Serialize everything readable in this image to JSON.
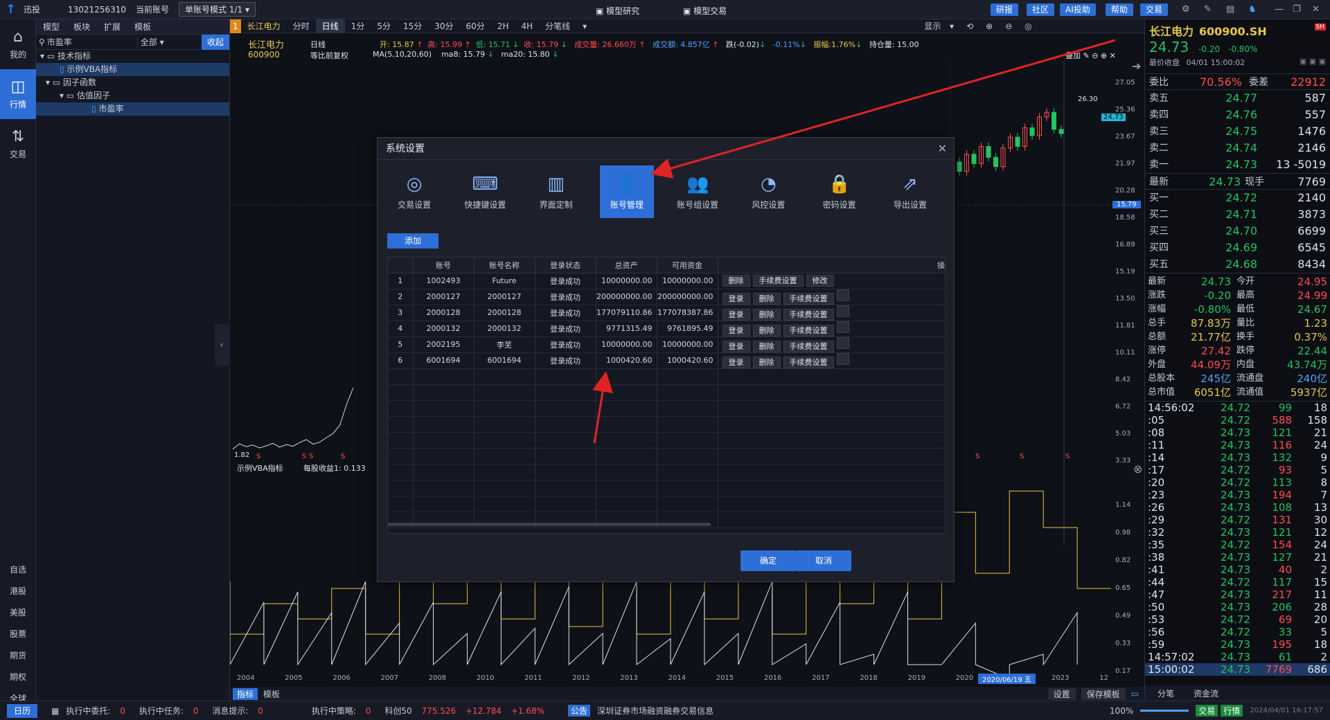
{
  "titlebar": {
    "app": "迅投",
    "phone": "13021256310",
    "account_label": "当前账号",
    "mode": "单账号模式 1/1",
    "center_left": "模型研究",
    "center_right": "模型交易",
    "buttons": [
      "研报",
      "社区",
      "AI投助",
      "帮助",
      "交易"
    ]
  },
  "leftnav": {
    "items": [
      {
        "label": "我的"
      },
      {
        "label": "行情"
      },
      {
        "label": "交易"
      }
    ],
    "bottom": [
      "自选",
      "港股",
      "美股",
      "股票",
      "期货",
      "期权",
      "全球"
    ]
  },
  "tree": {
    "tabs": [
      "模型",
      "板块",
      "扩展",
      "模板"
    ],
    "search_value": "市盈率",
    "filter": "全部",
    "collapse": "收起",
    "rows": [
      {
        "label": "技术指标"
      },
      {
        "label": "示例VBA指标"
      },
      {
        "label": "因子函数"
      },
      {
        "label": "估值因子"
      },
      {
        "label": "市盈率"
      }
    ]
  },
  "chart": {
    "badge": "1",
    "tabs": [
      "长江电力",
      "分时",
      "日线",
      "1分",
      "5分",
      "15分",
      "30分",
      "60分",
      "2H",
      "4H",
      "分笔线"
    ],
    "display": "显示",
    "stock_name": "长江电力",
    "stock_code": "600900",
    "period": "日线",
    "adjust": "等比前复权",
    "info": {
      "open": "开: 15.87",
      "high": "高: 15.99",
      "low": "低: 15.71",
      "close": "收: 15.79",
      "vol": "成交量: 26.660万",
      "amt": "成交额: 4.857亿",
      "chg": "跌(-0.02)",
      "pct": "-0.11%",
      "amp": "振幅:1.76%",
      "pos": "持仓量: 15.00",
      "ma_label": "MA(5,10,20,60)",
      "ma8": "ma8: 15.79",
      "ma20": "ma20: 15.80"
    },
    "overlay": "叠加",
    "high_mark": "26.30",
    "price_tag": "24.73",
    "cross_tag": "15.79",
    "low_mark": "1.82",
    "indicator_label": "示例VBA指标",
    "indicator_value": "每股收益1: 0.133",
    "s_marks": [
      "S",
      "S",
      "S",
      "S",
      "S",
      "S",
      "S"
    ],
    "yaxis_top": [
      "27.05",
      "25.36",
      "23.67",
      "21.97",
      "20.28",
      "18.58",
      "16.89",
      "15.19",
      "13.50",
      "11.81",
      "10.11",
      "8.42",
      "6.72",
      "5.03",
      "3.33"
    ],
    "yaxis_bottom": [
      "1.14",
      "0.98",
      "0.82",
      "0.65",
      "0.49",
      "0.33",
      "0.17"
    ],
    "xaxis": [
      "2004",
      "2005",
      "2006",
      "2007",
      "2008",
      "2010",
      "2011",
      "2012",
      "2013",
      "2014",
      "2015",
      "2016",
      "2017",
      "2018",
      "2019",
      "2020",
      "2022",
      "2023",
      "12"
    ],
    "x_highlight": "2020/06/19 五",
    "bottom_tabs": [
      "指标",
      "模板"
    ],
    "bottom_right": [
      "设置",
      "保存模板"
    ],
    "candles": [
      18.2,
      18.9,
      18.4,
      19.6,
      19.1,
      20.3,
      19.7,
      20.8,
      20.2,
      21.4,
      20.6,
      21.9,
      21.0,
      20.4,
      21.7,
      22.5,
      21.8,
      22.9,
      22.3,
      23.4,
      22.8,
      23.9,
      23.2,
      22.6,
      23.8,
      24.5,
      23.9,
      25.1,
      24.6,
      25.8,
      26.1,
      25.0,
      24.73
    ],
    "indicator_series": [
      1.82,
      1.95,
      1.88,
      1.92,
      1.85,
      1.9,
      1.96,
      1.87,
      1.93,
      1.89,
      1.98,
      2.05,
      1.94,
      1.99,
      2.1,
      2.2,
      2.4,
      2.9,
      3.3
    ],
    "lower_steps": [
      0.2,
      0.4,
      0.3,
      0.5,
      0.2,
      0.6,
      0.4,
      0.7,
      0.3,
      0.65,
      0.25,
      0.7,
      0.2,
      0.75,
      0.3,
      0.7,
      0.2,
      0.8,
      0.4,
      0.9,
      0.3,
      1.0,
      0.6,
      1.14,
      0.9,
      0.5
    ]
  },
  "quote": {
    "name": "长江电力",
    "code": "600900.SH",
    "price": "24.73",
    "chg": "-0.20",
    "pct": "-0.80%",
    "close_label": "最价收盘",
    "datetime": "04/01 15:00:02",
    "wb_label": "委比",
    "wb": "70.56%",
    "wc_label": "委差",
    "wc": "22912",
    "asks": [
      {
        "k": "卖五",
        "p": "24.77",
        "v": "587"
      },
      {
        "k": "卖四",
        "p": "24.76",
        "v": "557"
      },
      {
        "k": "卖三",
        "p": "24.75",
        "v": "1476"
      },
      {
        "k": "卖二",
        "p": "24.74",
        "v": "2146"
      },
      {
        "k": "卖一",
        "p": "24.73",
        "v": "13 -5019"
      }
    ],
    "last": {
      "k": "最新",
      "p": "24.73",
      "tag": "现手",
      "v": "7769"
    },
    "bids": [
      {
        "k": "买一",
        "p": "24.72",
        "v": "2140"
      },
      {
        "k": "买二",
        "p": "24.71",
        "v": "3873"
      },
      {
        "k": "买三",
        "p": "24.70",
        "v": "6699"
      },
      {
        "k": "买四",
        "p": "24.69",
        "v": "6545"
      },
      {
        "k": "买五",
        "p": "24.68",
        "v": "8434"
      }
    ],
    "stats": [
      {
        "k": "最新",
        "v": "24.73",
        "c1": "dn",
        "k2": "今开",
        "v2": "24.95",
        "c2": "up"
      },
      {
        "k": "涨跌",
        "v": "-0.20",
        "c1": "dn",
        "k2": "最高",
        "v2": "24.99",
        "c2": "up"
      },
      {
        "k": "涨幅",
        "v": "-0.80%",
        "c1": "dn",
        "k2": "最低",
        "v2": "24.67",
        "c2": "dn"
      },
      {
        "k": "总手",
        "v": "87.83万",
        "c1": "yl",
        "k2": "量比",
        "v2": "1.23",
        "c2": "yl"
      },
      {
        "k": "总额",
        "v": "21.77亿",
        "c1": "yl",
        "k2": "换手",
        "v2": "0.37%",
        "c2": "yl"
      },
      {
        "k": "涨停",
        "v": "27.42",
        "c1": "up",
        "k2": "跌停",
        "v2": "22.44",
        "c2": "dn"
      },
      {
        "k": "外盘",
        "v": "44.09万",
        "c1": "up",
        "k2": "内盘",
        "v2": "43.74万",
        "c2": "dn"
      },
      {
        "k": "总股本",
        "v": "245亿",
        "c1": "bl",
        "k2": "流通盘",
        "v2": "240亿",
        "c2": "bl"
      },
      {
        "k": "总市值",
        "v": "6051亿",
        "c1": "yl",
        "k2": "流通值",
        "v2": "5937亿",
        "c2": "yl"
      }
    ],
    "ticks": [
      {
        "t": "14:56:02",
        "p": "24.72",
        "v": "99",
        "n": "18"
      },
      {
        "t": ":05",
        "p": "24.72",
        "v": "588",
        "n": "158"
      },
      {
        "t": ":08",
        "p": "24.73",
        "v": "121",
        "n": "21"
      },
      {
        "t": ":11",
        "p": "24.73",
        "v": "116",
        "n": "24"
      },
      {
        "t": ":14",
        "p": "24.73",
        "v": "132",
        "n": "9"
      },
      {
        "t": ":17",
        "p": "24.72",
        "v": "93",
        "n": "5"
      },
      {
        "t": ":20",
        "p": "24.72",
        "v": "113",
        "n": "8"
      },
      {
        "t": ":23",
        "p": "24.73",
        "v": "194",
        "n": "7"
      },
      {
        "t": ":26",
        "p": "24.73",
        "v": "108",
        "n": "13"
      },
      {
        "t": ":29",
        "p": "24.72",
        "v": "131",
        "n": "30"
      },
      {
        "t": ":32",
        "p": "24.73",
        "v": "121",
        "n": "12"
      },
      {
        "t": ":35",
        "p": "24.72",
        "v": "154",
        "n": "24"
      },
      {
        "t": ":38",
        "p": "24.73",
        "v": "127",
        "n": "21"
      },
      {
        "t": ":41",
        "p": "24.73",
        "v": "40",
        "n": "2"
      },
      {
        "t": ":44",
        "p": "24.72",
        "v": "117",
        "n": "15"
      },
      {
        "t": ":47",
        "p": "24.73",
        "v": "217",
        "n": "11"
      },
      {
        "t": ":50",
        "p": "24.73",
        "v": "206",
        "n": "28"
      },
      {
        "t": ":53",
        "p": "24.72",
        "v": "69",
        "n": "20"
      },
      {
        "t": ":56",
        "p": "24.72",
        "v": "33",
        "n": "5"
      },
      {
        "t": ":59",
        "p": "24.73",
        "v": "195",
        "n": "18"
      },
      {
        "t": "14:57:02",
        "p": "24.73",
        "v": "61",
        "n": "2"
      },
      {
        "t": "15:00:02",
        "p": "24.73",
        "v": "7769",
        "n": "686"
      }
    ],
    "bottom_tabs": [
      "分笔",
      "资金流"
    ]
  },
  "status": {
    "calendar": "日历",
    "exec_entrust_label": "执行中委托:",
    "exec_entrust": "0",
    "exec_task_label": "执行中任务:",
    "exec_task": "0",
    "msg_label": "消息提示:",
    "msg": "0",
    "exec_strategy_label": "执行中策略:",
    "exec_strategy": "0",
    "kc50": "科创50",
    "kc50_v": "775.526",
    "kc50_c": "+12.784",
    "kc50_p": "+1.68%",
    "notice_tag": "公告",
    "notice": "深圳证券市场融资融券交易信息",
    "zoom": "100%",
    "tab_trade": "交易",
    "tab_quote": "行情",
    "clock": "2024/04/01 16:17:57"
  },
  "dialog": {
    "title": "系统设置",
    "tabs": [
      "交易设置",
      "快捷键设置",
      "界面定制",
      "账号管理",
      "账号组设置",
      "风控设置",
      "密码设置",
      "导出设置"
    ],
    "active_tab": 3,
    "add_button": "添加",
    "columns": [
      "",
      "账号",
      "账号名称",
      "登录状态",
      "总资产",
      "可用资金",
      "操作"
    ],
    "rows": [
      {
        "no": "1",
        "acct": "1002493",
        "name": "Future",
        "status": "登录成功",
        "total": "10000000.00",
        "avail": "10000000.00",
        "ops": [
          "删除",
          "手续费设置",
          "修改"
        ]
      },
      {
        "no": "2",
        "acct": "2000127",
        "name": "2000127",
        "status": "登录成功",
        "total": "200000000.00",
        "avail": "200000000.00",
        "ops": [
          "登录",
          "删除",
          "手续费设置",
          ""
        ]
      },
      {
        "no": "3",
        "acct": "2000128",
        "name": "2000128",
        "status": "登录成功",
        "total": "177079110.86",
        "avail": "177078387.86",
        "ops": [
          "登录",
          "删除",
          "手续费设置",
          ""
        ]
      },
      {
        "no": "4",
        "acct": "2000132",
        "name": "2000132",
        "status": "登录成功",
        "total": "9771315.49",
        "avail": "9761895.49",
        "ops": [
          "登录",
          "删除",
          "手续费设置",
          ""
        ]
      },
      {
        "no": "5",
        "acct": "2002195",
        "name": "李芜",
        "status": "登录成功",
        "total": "10000000.00",
        "avail": "10000000.00",
        "ops": [
          "登录",
          "删除",
          "手续费设置",
          ""
        ]
      },
      {
        "no": "6",
        "acct": "6001694",
        "name": "6001694",
        "status": "登录成功",
        "total": "1000420.60",
        "avail": "1000420.60",
        "ops": [
          "登录",
          "删除",
          "手续费设置",
          ""
        ]
      }
    ],
    "ok": "确定",
    "cancel": "取消"
  },
  "colors": {
    "accent": "#2d6fd6",
    "up": "#ff4d4f",
    "down": "#22c55e",
    "arrow": "#e02424"
  }
}
